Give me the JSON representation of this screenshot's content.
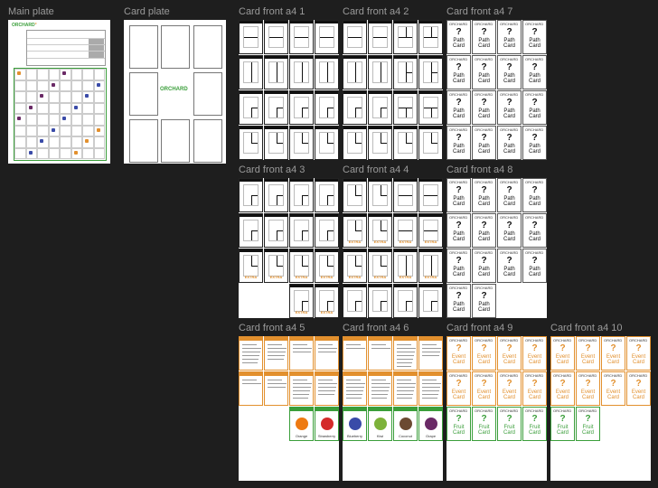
{
  "frames": [
    {
      "id": "main-plate",
      "label": "Main plate"
    },
    {
      "id": "card-plate",
      "label": "Card plate"
    },
    {
      "id": "a4-1",
      "label": "Card front a4 1"
    },
    {
      "id": "a4-2",
      "label": "Card front a4 2"
    },
    {
      "id": "a4-7",
      "label": "Card front a4 7"
    },
    {
      "id": "a4-3",
      "label": "Card front a4 3"
    },
    {
      "id": "a4-4",
      "label": "Card front a4 4"
    },
    {
      "id": "a4-8",
      "label": "Card front a4 8"
    },
    {
      "id": "a4-5",
      "label": "Card front a4 5"
    },
    {
      "id": "a4-6",
      "label": "Card front a4 6"
    },
    {
      "id": "a4-9",
      "label": "Card front a4 9"
    },
    {
      "id": "a4-10",
      "label": "Card front a4 10"
    }
  ],
  "brand": "ORCHARD",
  "back_text": {
    "q": "?",
    "path": [
      "Path",
      "Card"
    ],
    "event": [
      "Event",
      "Card"
    ],
    "fruit": [
      "Fruit",
      "Card"
    ]
  },
  "fruits": [
    "Orange",
    "Strawberry",
    "Blueberry",
    "Kiwi",
    "Coconut",
    "Grape"
  ],
  "colors": {
    "canvas": "#1e1e1e",
    "label": "#9a9a9a",
    "event": "#e2902e",
    "fruit": "#3a9e3a",
    "ink": "#111111"
  }
}
